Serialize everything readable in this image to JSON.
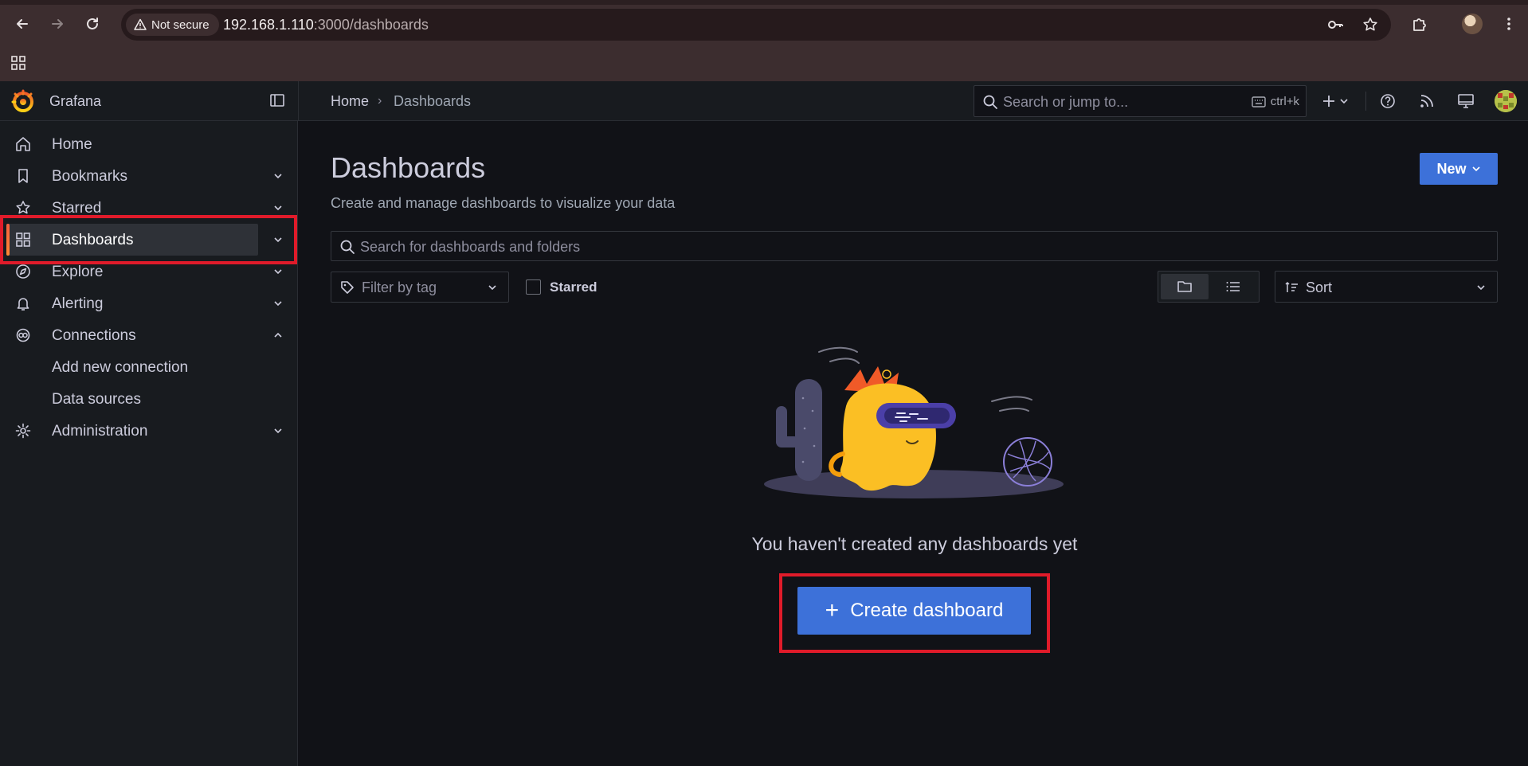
{
  "browser": {
    "security_label": "Not secure",
    "url_host": "192.168.1.110",
    "url_rest": ":3000/dashboards"
  },
  "app": {
    "brand": "Grafana",
    "breadcrumb": {
      "home": "Home",
      "separator": "›",
      "current": "Dashboards"
    },
    "search": {
      "placeholder": "Search or jump to...",
      "shortcut": "ctrl+k"
    }
  },
  "sidebar": {
    "items": [
      {
        "label": "Home",
        "icon": "home-icon"
      },
      {
        "label": "Bookmarks",
        "icon": "bookmark-icon"
      },
      {
        "label": "Starred",
        "icon": "star-icon"
      },
      {
        "label": "Dashboards",
        "icon": "dashboards-grid-icon",
        "active": true
      },
      {
        "label": "Explore",
        "icon": "compass-icon"
      },
      {
        "label": "Alerting",
        "icon": "bell-icon"
      },
      {
        "label": "Connections",
        "icon": "connections-icon",
        "expanded": true
      },
      {
        "label": "Add new connection"
      },
      {
        "label": "Data sources"
      },
      {
        "label": "Administration",
        "icon": "gear-icon"
      }
    ]
  },
  "main": {
    "title": "Dashboards",
    "subtitle": "Create and manage dashboards to visualize your data",
    "new_button": "New",
    "search_placeholder": "Search for dashboards and folders",
    "filter_tag_placeholder": "Filter by tag",
    "starred_label": "Starred",
    "sort_label": "Sort",
    "empty_message": "You haven't created any dashboards yet",
    "create_button": "Create dashboard"
  },
  "colors": {
    "accent": "#3d71d9",
    "active_bar": "#f55f3e",
    "highlight": "#e01b2a"
  }
}
